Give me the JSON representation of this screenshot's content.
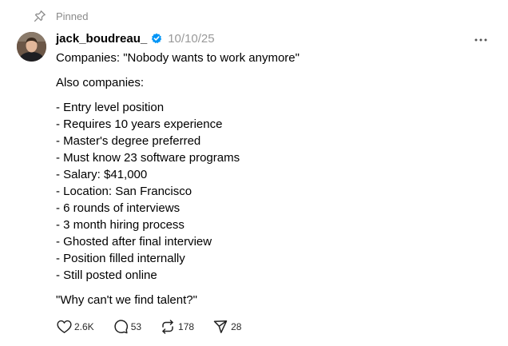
{
  "pinned": {
    "label": "Pinned",
    "icon": "pin-icon"
  },
  "author": {
    "username": "jack_boudreau_",
    "verified": true,
    "verified_color": "#0095f6",
    "timestamp": "10/10/25"
  },
  "post": {
    "paragraphs": [
      "Companies: \"Nobody wants to work anymore\"",
      "Also companies:"
    ],
    "list": [
      "- Entry level position",
      "- Requires 10 years experience",
      "- Master's degree preferred",
      "- Must know 23 software programs",
      "- Salary: $41,000",
      "- Location: San Francisco",
      "- 6 rounds of interviews",
      "- 3 month hiring process",
      "- Ghosted after final interview",
      "- Position filled internally",
      "- Still posted online"
    ],
    "closing": "\"Why can't we find talent?\""
  },
  "actions": {
    "likes": "2.6K",
    "replies": "53",
    "reposts": "178",
    "shares": "28"
  },
  "icons": {
    "more": "more-options-icon",
    "like": "heart-icon",
    "reply": "comment-icon",
    "repost": "repost-icon",
    "share": "share-icon"
  }
}
